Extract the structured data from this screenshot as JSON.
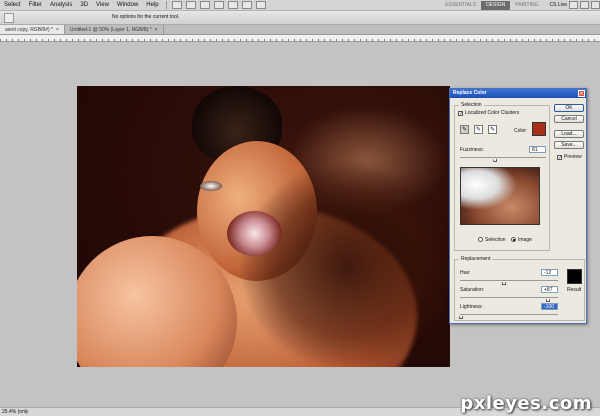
{
  "menubar": {
    "items": [
      "Select",
      "Filter",
      "Analysis",
      "3D",
      "View",
      "Window",
      "Help"
    ],
    "workspaces": [
      "ESSENTIALS",
      "DESIGN",
      "PAINTING"
    ],
    "active_workspace": "DESIGN",
    "cs_live": "CS Live"
  },
  "options_bar": {
    "message": "No options for the current tool."
  },
  "tabs": [
    {
      "label": "ased copy, RGB/8#) *",
      "active": true
    },
    {
      "label": "Untitled-1 @ 50% (Layer 1, RGB/8) *",
      "active": false
    }
  ],
  "dialog": {
    "title": "Replace Color",
    "selection_group": "Selection",
    "localized_clusters_label": "Localized Color Clusters",
    "localized_clusters_checked": true,
    "color_label": "Color:",
    "color_value": "#a8301a",
    "fuzziness_label": "Fuzziness:",
    "fuzziness_value": "81",
    "fuzziness_level": 0.41,
    "preview_mode_selection": "Selection",
    "preview_mode_image": "Image",
    "preview_mode_checked": "Image",
    "replacement_group": "Replacement",
    "hue_label": "Hue:",
    "hue_value": "-12",
    "saturation_label": "Saturation:",
    "saturation_value": "+87",
    "lightness_label": "Lightness:",
    "lightness_value": "-100",
    "result_label": "Result",
    "result_color": "#000000",
    "buttons": {
      "ok": "OK",
      "cancel": "Cancel",
      "load": "Load...",
      "save": "Save..."
    },
    "preview_label": "Preview",
    "preview_checked": true
  },
  "status": {
    "zoom": "25.4% (only"
  },
  "watermark": "pxleyes.com"
}
